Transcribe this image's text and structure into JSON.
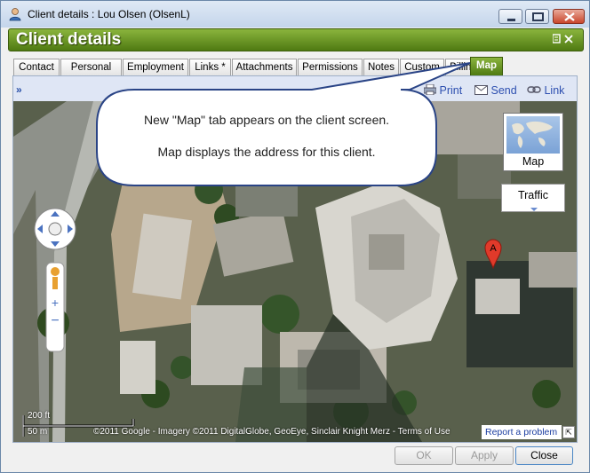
{
  "window": {
    "title": "Client details : Lou Olsen  (OlsenL)",
    "icon": "client-user-icon"
  },
  "header": {
    "title": "Client details"
  },
  "tabs": [
    {
      "label": "Contact"
    },
    {
      "label": "Personal"
    },
    {
      "label": "Employment"
    },
    {
      "label": "Links *"
    },
    {
      "label": "Attachments"
    },
    {
      "label": "Permissions"
    },
    {
      "label": "Notes"
    },
    {
      "label": "Custom"
    },
    {
      "label": "Billing"
    },
    {
      "label": "Map",
      "active": true
    }
  ],
  "map_toolbar": {
    "print": "Print",
    "send": "Send",
    "link": "Link"
  },
  "callout": {
    "line1": "New \"Map\" tab appears on the client screen.",
    "line2": "Map displays the address for this client."
  },
  "map": {
    "map_type_label": "Map",
    "traffic_label": "Traffic",
    "marker_label": "A",
    "scale_top": "200 ft",
    "scale_bottom": "50 m",
    "attribution": "©2011 Google - Imagery ©2011 DigitalGlobe, GeoEye, Sinclair Knight Merz - Terms of Use",
    "report_problem": "Report a problem"
  },
  "buttons": {
    "ok": "OK",
    "apply": "Apply",
    "close": "Close"
  },
  "colors": {
    "header_green": "#5e8a1c",
    "link_blue": "#2d4fb0",
    "marker_red": "#e03a2a"
  }
}
